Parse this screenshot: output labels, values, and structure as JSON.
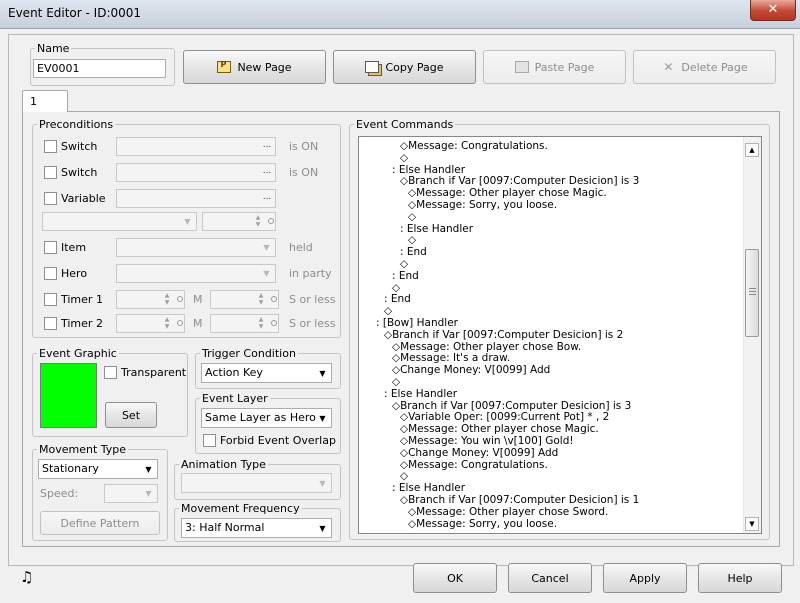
{
  "window": {
    "title": "Event Editor - ID:0001",
    "close_glyph": "✕"
  },
  "name_group": {
    "legend": "Name",
    "value": "EV0001"
  },
  "toolbar": {
    "new_page": "New Page",
    "copy_page": "Copy Page",
    "paste_page": "Paste Page",
    "delete_page": "Delete Page"
  },
  "tabs": [
    "1"
  ],
  "preconditions": {
    "legend": "Preconditions",
    "switch1_label": "Switch",
    "switch1_suffix": "is ON",
    "switch2_label": "Switch",
    "switch2_suffix": "is ON",
    "variable_label": "Variable",
    "item_label": "Item",
    "item_suffix": "held",
    "hero_label": "Hero",
    "hero_suffix": "in party",
    "timer1_label": "Timer 1",
    "timer1_unit": "M",
    "timer1_suffix": "S or less",
    "timer2_label": "Timer 2",
    "timer2_unit": "M",
    "timer2_suffix": "S or less",
    "ellipsis": "..."
  },
  "event_graphic": {
    "legend": "Event Graphic",
    "transparent_label": "Transparent",
    "set_label": "Set",
    "swatch_color": "#00ff00"
  },
  "trigger_condition": {
    "legend": "Trigger Condition",
    "value": "Action Key"
  },
  "event_layer": {
    "legend": "Event Layer",
    "value": "Same Layer as Hero",
    "forbid_overlap_label": "Forbid Event Overlap"
  },
  "movement_type": {
    "legend": "Movement Type",
    "value": "Stationary",
    "speed_label": "Speed:",
    "define_pattern_label": "Define Pattern"
  },
  "animation_type": {
    "legend": "Animation Type",
    "value": ""
  },
  "movement_frequency": {
    "legend": "Movement Frequency",
    "value": "3: Half Normal"
  },
  "event_commands": {
    "legend": "Event Commands",
    "lines": [
      {
        "indent": 4,
        "text": "◇Message: Congratulations."
      },
      {
        "indent": 4,
        "text": "◇"
      },
      {
        "indent": 3,
        "text": ": Else Handler"
      },
      {
        "indent": 4,
        "text": "◇Branch if Var [0097:Computer Desicion] is 3"
      },
      {
        "indent": 5,
        "text": "◇Message: Other player chose Magic."
      },
      {
        "indent": 5,
        "text": "◇Message: Sorry, you loose."
      },
      {
        "indent": 5,
        "text": "◇"
      },
      {
        "indent": 4,
        "text": ": Else Handler"
      },
      {
        "indent": 5,
        "text": "◇"
      },
      {
        "indent": 4,
        "text": ": End"
      },
      {
        "indent": 4,
        "text": "◇"
      },
      {
        "indent": 3,
        "text": ": End"
      },
      {
        "indent": 3,
        "text": "◇"
      },
      {
        "indent": 2,
        "text": ": End"
      },
      {
        "indent": 2,
        "text": "◇"
      },
      {
        "indent": 1,
        "text": ": [Bow] Handler"
      },
      {
        "indent": 2,
        "text": "◇Branch if Var [0097:Computer Desicion] is 2"
      },
      {
        "indent": 3,
        "text": "◇Message: Other player chose Bow."
      },
      {
        "indent": 3,
        "text": "◇Message: It's a draw."
      },
      {
        "indent": 3,
        "text": "◇Change Money: V[0099] Add"
      },
      {
        "indent": 3,
        "text": "◇"
      },
      {
        "indent": 2,
        "text": ": Else Handler"
      },
      {
        "indent": 3,
        "text": "◇Branch if Var [0097:Computer Desicion] is 3"
      },
      {
        "indent": 4,
        "text": "◇Variable Oper: [0099:Current Pot] * , 2"
      },
      {
        "indent": 4,
        "text": "◇Message: Other player chose Magic."
      },
      {
        "indent": 4,
        "text": "◇Message: You win \\v[100] Gold!"
      },
      {
        "indent": 4,
        "text": "◇Change Money: V[0099] Add"
      },
      {
        "indent": 4,
        "text": "◇Message: Congratulations."
      },
      {
        "indent": 4,
        "text": "◇"
      },
      {
        "indent": 3,
        "text": ": Else Handler"
      },
      {
        "indent": 4,
        "text": "◇Branch if Var [0097:Computer Desicion] is 1"
      },
      {
        "indent": 5,
        "text": "◇Message: Other player chose Sword."
      },
      {
        "indent": 5,
        "text": "◇Message: Sorry, you loose."
      }
    ]
  },
  "footer": {
    "ok": "OK",
    "cancel": "Cancel",
    "apply": "Apply",
    "help": "Help",
    "music_icon": "♫"
  }
}
